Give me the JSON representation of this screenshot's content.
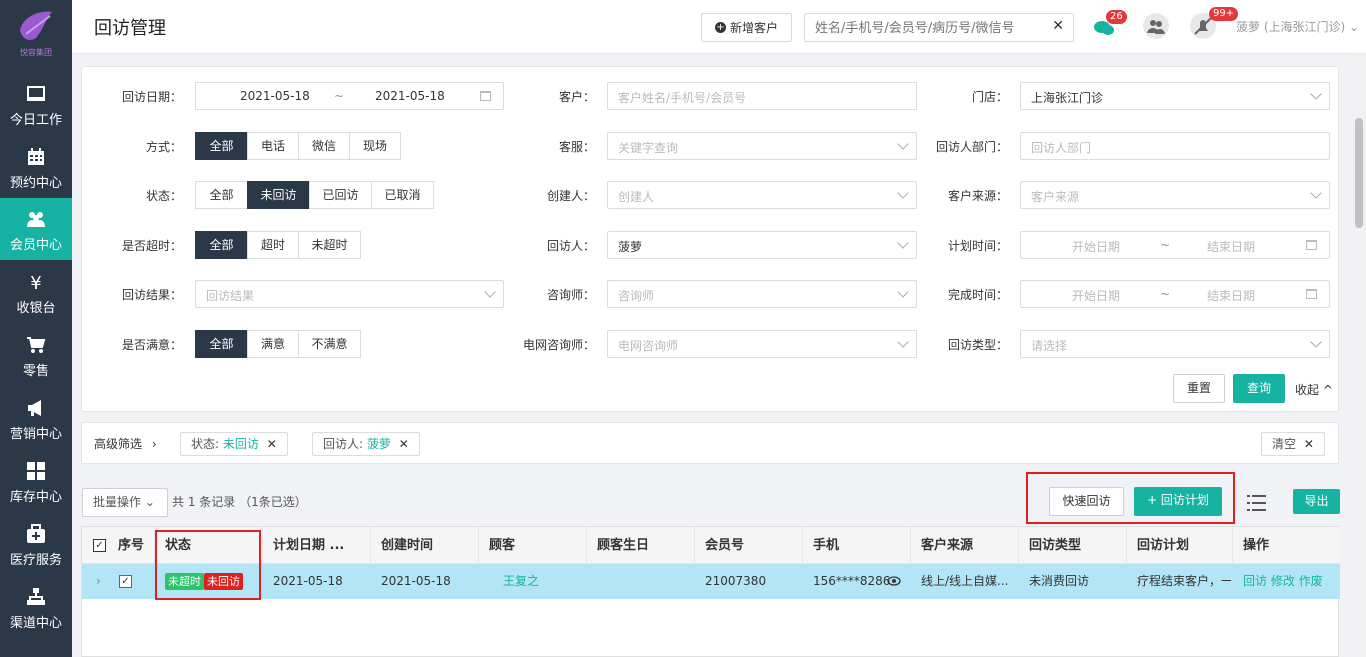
{
  "sidebar": {
    "logo_text": "悦容集团",
    "items": [
      {
        "label": "今日工作",
        "icon": "monitor-icon"
      },
      {
        "label": "预约中心",
        "icon": "calendar-icon"
      },
      {
        "label": "会员中心",
        "icon": "users-icon"
      },
      {
        "label": "收银台",
        "icon": "yen-icon"
      },
      {
        "label": "零售",
        "icon": "cart-icon"
      },
      {
        "label": "营销中心",
        "icon": "megaphone-icon"
      },
      {
        "label": "库存中心",
        "icon": "grid-icon"
      },
      {
        "label": "医疗服务",
        "icon": "medkit-icon"
      },
      {
        "label": "渠道中心",
        "icon": "org-chart-icon"
      }
    ]
  },
  "header": {
    "title": "回访管理",
    "new_customer": "新增客户",
    "search_placeholder": "姓名/手机号/会员号/病历号/微信号",
    "chat_badge": "26",
    "notice_badge": "99+",
    "user": "菠萝 (上海张江门诊)"
  },
  "filters": {
    "visit_date_label": "回访日期：",
    "date_from": "2021-05-18",
    "date_tilde": "~",
    "date_to": "2021-05-18",
    "customer_label": "客户：",
    "customer_ph": "客户姓名/手机号/会员号",
    "store_label": "门店：",
    "store_value": "上海张江门诊",
    "method_label": "方式：",
    "method_opts": [
      "全部",
      "电话",
      "微信",
      "现场"
    ],
    "service_label": "客服：",
    "service_ph": "关键字查询",
    "dept_label": "回访人部门：",
    "dept_ph": "回访人部门",
    "status_label": "状态：",
    "status_opts": [
      "全部",
      "未回访",
      "已回访",
      "已取消"
    ],
    "creator_label": "创建人：",
    "creator_ph": "创建人",
    "source_label": "客户来源：",
    "source_ph": "客户来源",
    "overtime_label": "是否超时：",
    "overtime_opts": [
      "全部",
      "超时",
      "未超时"
    ],
    "visitor_label": "回访人：",
    "visitor_value": "菠萝",
    "plan_time_label": "计划时间：",
    "start_ph": "开始日期",
    "end_ph": "结束日期",
    "result_label": "回访结果：",
    "result_ph": "回访结果",
    "consultant_label": "咨询师：",
    "consultant_ph": "咨询师",
    "done_time_label": "完成时间：",
    "satisfied_label": "是否满意：",
    "satisfied_opts": [
      "全部",
      "满意",
      "不满意"
    ],
    "online_label": "电网咨询师：",
    "online_ph": "电网咨询师",
    "type_label": "回访类型：",
    "type_ph": "请选择",
    "reset": "重置",
    "query": "查询",
    "collapse": "收起"
  },
  "adv": {
    "label": "高级筛选",
    "tag1_key": "状态: ",
    "tag1_val": "未回访",
    "tag2_key": "回访人: ",
    "tag2_val": "菠萝",
    "clear": "清空"
  },
  "toolbar": {
    "batch": "批量操作",
    "count": "共 1 条记录 （1条已选）",
    "quick": "快速回访",
    "plan": "+ 回访计划",
    "export": "导出"
  },
  "table": {
    "headers": [
      "序号",
      "状态",
      "计划日期 ...",
      "创建时间",
      "顾客",
      "顾客生日",
      "会员号",
      "手机",
      "客户来源",
      "回访类型",
      "回访计划",
      "操作"
    ],
    "row": {
      "badge1": "未超时",
      "badge2": "未回访",
      "plan_date": "2021-05-18",
      "created": "2021-05-18",
      "customer": "王复之",
      "birthday": "",
      "member_no": "21007380",
      "phone": "156****8286",
      "source": "线上/线上自媒...",
      "type": "未消费回访",
      "plan": "疗程结束客户，一",
      "act1": "回访",
      "act2": "修改",
      "act3": "作废"
    }
  }
}
